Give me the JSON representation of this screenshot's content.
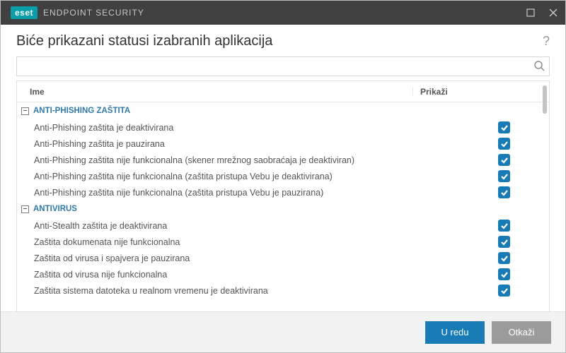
{
  "brand": {
    "badge": "eset",
    "product": "ENDPOINT SECURITY"
  },
  "page_title": "Biće prikazani statusi izabranih aplikacija",
  "help_symbol": "?",
  "search": {
    "value": "",
    "placeholder": ""
  },
  "columns": {
    "name": "Ime",
    "show": "Prikaži"
  },
  "collapse_glyph": "–",
  "groups": [
    {
      "title": "ANTI-PHISHING ZAŠTITA",
      "items": [
        {
          "label": "Anti-Phishing zaštita je deaktivirana",
          "checked": true
        },
        {
          "label": "Anti-Phishing zaštita je pauzirana",
          "checked": true
        },
        {
          "label": "Anti-Phishing zaštita nije funkcionalna (skener mrežnog saobraćaja je deaktiviran)",
          "checked": true
        },
        {
          "label": "Anti-Phishing zaštita nije funkcionalna (zaštita pristupa Vebu je deaktivirana)",
          "checked": true
        },
        {
          "label": "Anti-Phishing zaštita nije funkcionalna (zaštita pristupa Vebu je pauzirana)",
          "checked": true
        }
      ]
    },
    {
      "title": "ANTIVIRUS",
      "items": [
        {
          "label": "Anti-Stealth zaštita je deaktivirana",
          "checked": true
        },
        {
          "label": "Zaštita dokumenata nije funkcionalna",
          "checked": true
        },
        {
          "label": "Zaštita od virusa i spajvera je pauzirana",
          "checked": true
        },
        {
          "label": "Zaštita od virusa nije funkcionalna",
          "checked": true
        },
        {
          "label": "Zaštita sistema datoteka u realnom vremenu je deaktivirana",
          "checked": true
        }
      ]
    }
  ],
  "buttons": {
    "ok": "U redu",
    "cancel": "Otkaži"
  }
}
